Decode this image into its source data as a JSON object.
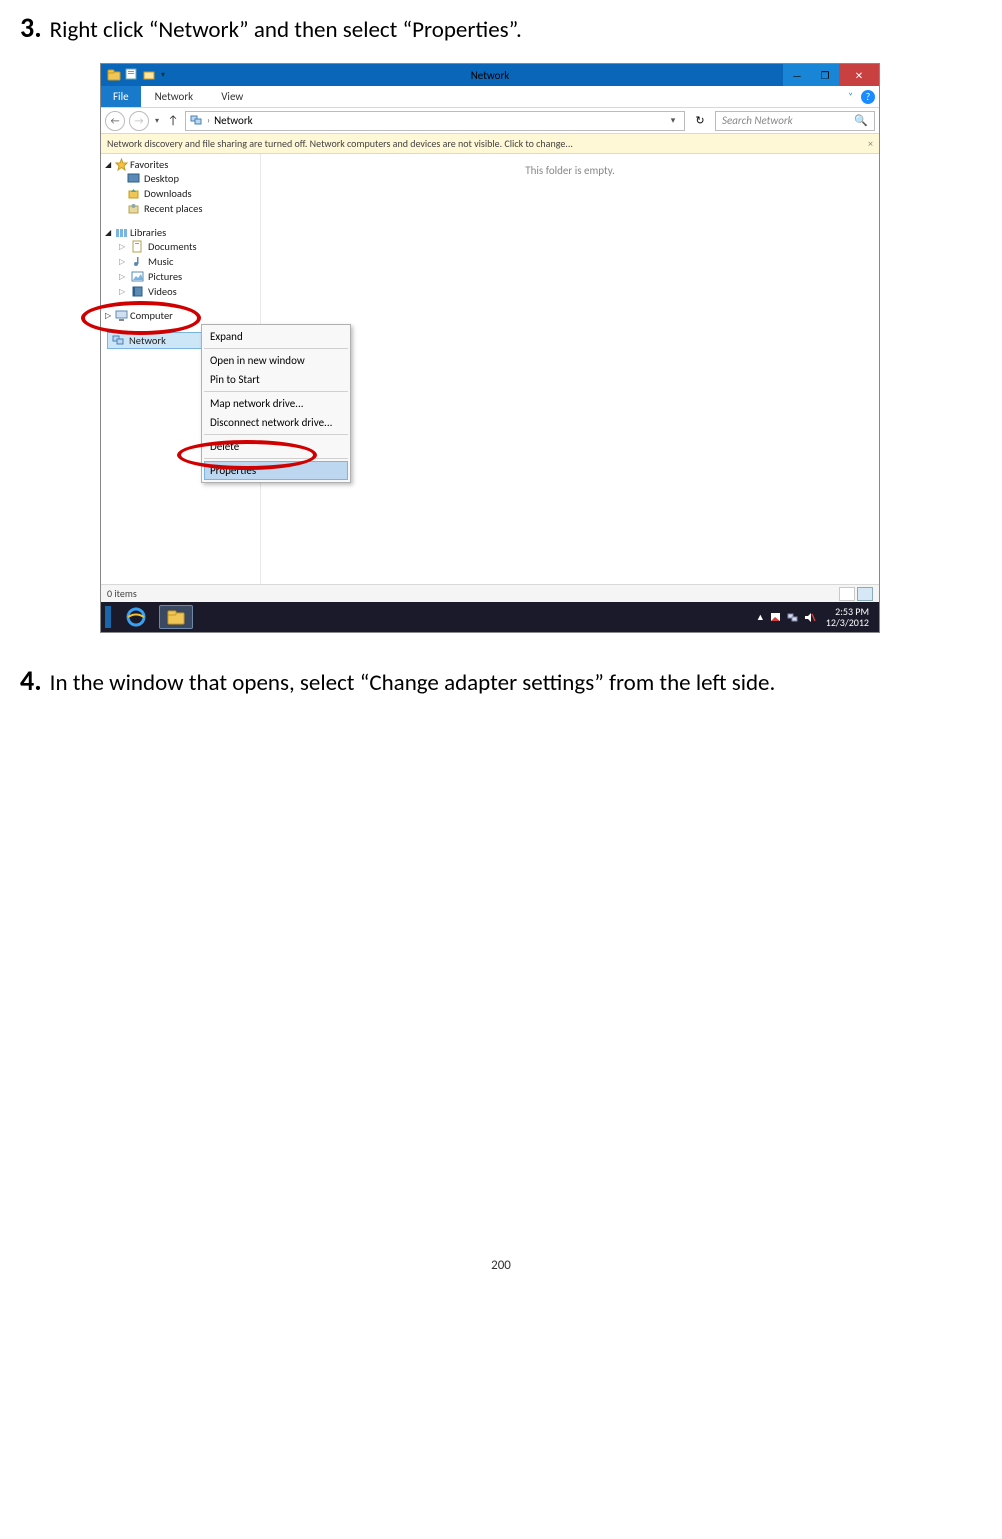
{
  "step3": {
    "num": "3.",
    "text": "Right click “Network” and then select “Properties”."
  },
  "step4": {
    "num": "4.",
    "text": "In the window that opens, select “Change adapter settings” from the left side."
  },
  "page_number": "200",
  "window": {
    "title": "Network",
    "tabs": {
      "file": "File",
      "network": "Network",
      "view": "View"
    },
    "address_text": "Network",
    "search_placeholder": "Search Network",
    "infobar": "Network discovery and file sharing are turned off. Network computers and devices are not visible. Click to change...",
    "infobar_close": "×",
    "empty_message": "This folder is empty.",
    "status": "0 items",
    "minimize": "—",
    "restore": "❐",
    "close": "✕",
    "dd_chevron": "˅",
    "help": "?"
  },
  "nav": {
    "back": "←",
    "fwd": "→",
    "dd": "▾",
    "up": "↑",
    "addr_chev": "›",
    "addr_dd": "▾",
    "refresh": "↻",
    "search_icon": "🔍"
  },
  "navpane": {
    "favorites": "Favorites",
    "fav_items": [
      "Desktop",
      "Downloads",
      "Recent places"
    ],
    "libraries": "Libraries",
    "lib_items": [
      "Documents",
      "Music",
      "Pictures",
      "Videos"
    ],
    "computer": "Computer",
    "network": "Network"
  },
  "context_menu": {
    "items": [
      "Expand",
      "Open in new window",
      "Pin to Start",
      "Map network drive...",
      "Disconnect network drive...",
      "Delete",
      "Properties"
    ]
  },
  "taskbar": {
    "tray_up": "▲",
    "time": "2:53 PM",
    "date": "12/3/2012"
  }
}
